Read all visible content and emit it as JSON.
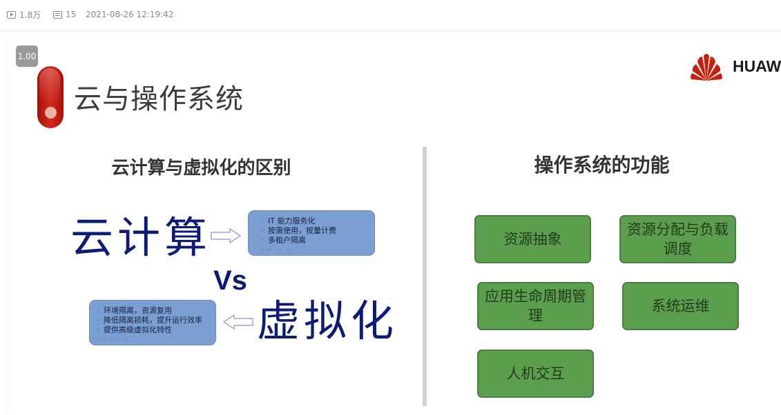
{
  "meta": {
    "views": "1.8万",
    "danmaku": "15",
    "datetime": "2021-08-26 12:19:42"
  },
  "player": {
    "speed": "1.00"
  },
  "slide": {
    "title": "云与操作系统",
    "logo_text": "HUAW",
    "left": {
      "heading": "云计算与虚拟化的区别",
      "cloud_label": "云计算",
      "cloud_points": [
        "IT 能力服务化",
        "按需使用，按量计费",
        "多租户隔离",
        "· · ·"
      ],
      "vs_label": "Vs",
      "virt_label": "虚拟化",
      "virt_points": [
        "环境隔离，资源复用",
        "降低隔离损耗，提升运行效率",
        "提供高级虚拟化特性",
        "· · ·"
      ]
    },
    "right": {
      "heading": "操作系统的功能",
      "functions": [
        "资源抽象",
        "资源分配与负载调度",
        "应用生命周期管理",
        "系统运维",
        "人机交互"
      ]
    }
  },
  "colors": {
    "brand_red": "#c8200f",
    "box_blue": "#7b9fd3",
    "box_green": "#5a9e4e",
    "text_navy": "#0c1a78"
  },
  "icons": [
    "play-count-icon",
    "danmaku-icon",
    "huawei-logo-icon",
    "right-arrow-icon",
    "left-arrow-icon"
  ]
}
